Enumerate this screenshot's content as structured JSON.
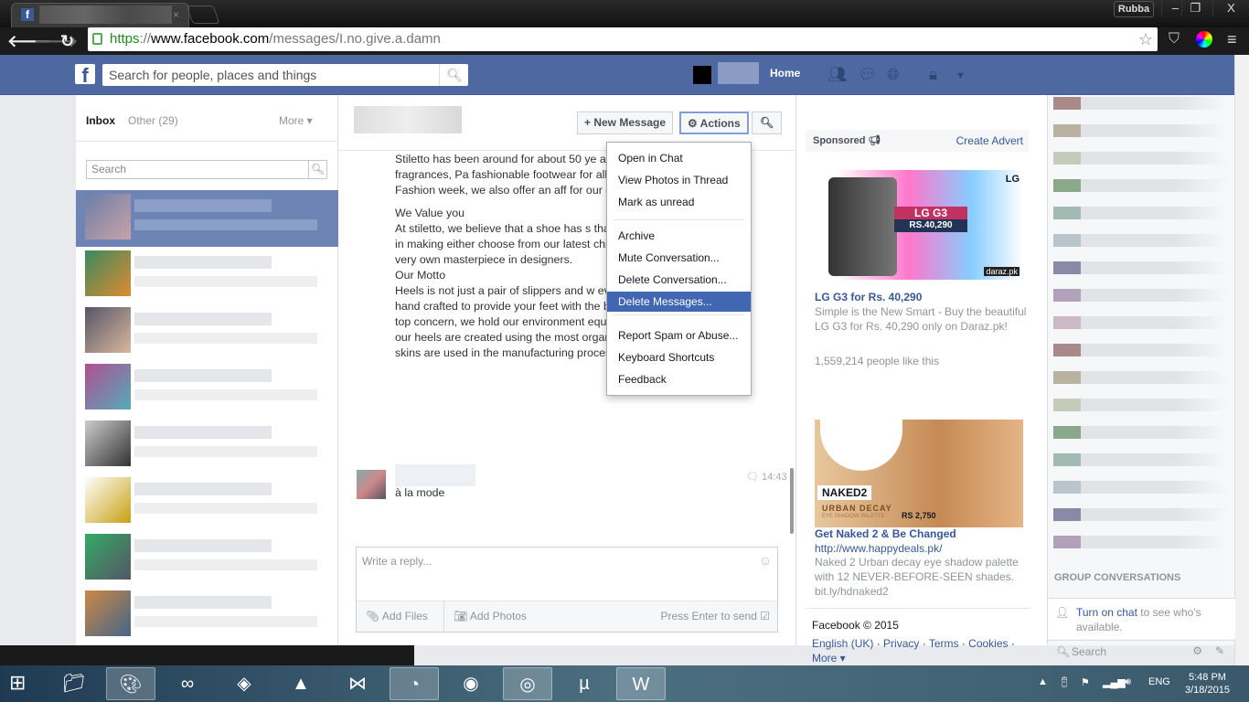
{
  "browser": {
    "tab_close": "×",
    "user": "Rubba",
    "minimize": "‒",
    "restore": "❐",
    "close": "X",
    "url_scheme": "https",
    "url_sep": "://",
    "url_host": "www.facebook.com",
    "url_path": "/messages/I.no.give.a.damn"
  },
  "header": {
    "logo": "f",
    "search_placeholder": "Search for people, places and things",
    "home": "Home"
  },
  "inbox": {
    "inbox": "Inbox",
    "other": "Other (29)",
    "more": "More ▾",
    "search_placeholder": "Search",
    "conversation_count": 8
  },
  "thread": {
    "new_message": "+ New Message",
    "actions": "⚙ Actions",
    "message_paragraphs": [
      "Stiletto has been around for about 50 ye at the heart of the city of fragrances, Pa fashionable footwear for all the dress de Paris Fashion week, we also offer an aff for our customers.",
      "We Value you\nAt stiletto, we believe that a shoe has s than just to walk. We believe in making either choose from our latest chic collec to create your very own masterpiece in designers.\nOur Motto\nHeels is not just a pair of slippers and w every one of our stilettos is hand crafted to provide your feet with the best stiletto quality is our top concern, we hold our environment equally dear and therefore, our heels are created using the most organic materials. No animal skins are used in the manufacturing process of our heels."
    ],
    "reply_text": "à la mode",
    "time": "14:43",
    "composer_placeholder": "Write a reply...",
    "add_files": "Add Files",
    "add_photos": "Add Photos",
    "press_enter": "Press Enter to send"
  },
  "actions_menu": {
    "items": [
      "Open in Chat",
      "View Photos in Thread",
      "Mark as unread",
      "Archive",
      "Mute Conversation...",
      "Delete Conversation...",
      "Delete Messages...",
      "Report Spam or Abuse...",
      "Keyboard Shortcuts",
      "Feedback"
    ],
    "highlighted": "Delete Messages..."
  },
  "ads": {
    "sponsored": "Sponsored",
    "create_advert": "Create Advert",
    "ad1": {
      "title": "LG G3 for Rs. 40,290",
      "desc": "Simple is the New Smart - Buy the beautiful LG G3 for Rs. 40,290 only on Daraz.pk!",
      "likes": "1,559,214 people like this",
      "img_title": "LG G3",
      "img_price": "RS.40,290",
      "img_brand": "LG",
      "img_store": "daraz.pk"
    },
    "ad2": {
      "title": "Get Naked 2 & Be Changed",
      "url": "http://www.happydeals.pk/",
      "desc": "Naked 2 Urban decay eye shadow palette with 12 NEVER-BEFORE-SEEN shades. bit.ly/hdnaked2",
      "img_title": "NAKED2",
      "img_sub": "URBAN DECAY",
      "img_sub2": "EYE SHADOW PALETTE",
      "img_price": "RS 2,750"
    },
    "footer": {
      "copyright": "Facebook © 2015",
      "links": [
        "English (UK)",
        "Privacy",
        "Terms",
        "Cookies"
      ],
      "more": "More ▾"
    }
  },
  "chat": {
    "group_conversations": "GROUP CONVERSATIONS",
    "turn_on": "Turn on chat",
    "turn_on_rest": " to see who's available.",
    "search": "Search"
  },
  "taskbar": {
    "apps": [
      "file-explorer",
      "paint",
      "arduino",
      "unity",
      "matlab",
      "visual-studio",
      "app",
      "vlc",
      "chrome",
      "utorrent",
      "word"
    ],
    "active": [
      "paint",
      "app",
      "chrome",
      "word"
    ],
    "lang": "ENG",
    "time": "5:48 PM",
    "date": "3/18/2015"
  },
  "colors": {
    "facebook_blue": "#4e69a2",
    "highlight": "#4267b2",
    "link": "#365899"
  }
}
